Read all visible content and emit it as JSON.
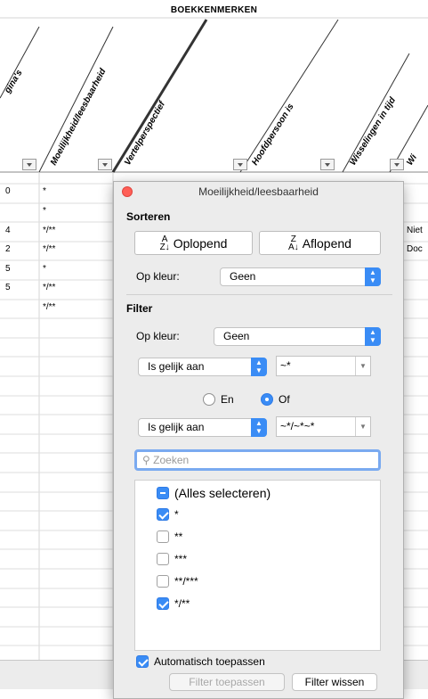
{
  "sheet": {
    "title": "BOEKKENMERKEN",
    "headers": [
      "gina's",
      "Moeilijkheid/leesbaarheid",
      "Vertelperspectief",
      "Hoofdpersoon is",
      "Wisselingen in tijd",
      "Wi"
    ],
    "col_a": [
      "0",
      "",
      "4",
      "2",
      "5",
      "5"
    ],
    "col_b": [
      "*",
      "*",
      "*/**",
      "*/**",
      "*",
      "*/**",
      "*/**"
    ],
    "col_right": [
      "Niet",
      "Doc"
    ]
  },
  "popup": {
    "title": "Moeilijkheid/leesbaarheid",
    "sort_section": "Sorteren",
    "sort_asc": "Oplopend",
    "sort_desc": "Aflopend",
    "sort_asc_icon": "AZ",
    "sort_desc_icon": "ZA",
    "sort_color_label": "Op kleur:",
    "sort_color_value": "Geen",
    "filter_section": "Filter",
    "filter_color_label": "Op kleur:",
    "filter_color_value": "Geen",
    "cond1_operator": "Is gelijk aan",
    "cond1_value": "~*",
    "and_label": "En",
    "or_label": "Of",
    "logic_selected": "Of",
    "cond2_operator": "Is gelijk aan",
    "cond2_value": "~*/~*~*",
    "search_placeholder": "Zoeken",
    "values": [
      {
        "label": "(Alles selecteren)",
        "state": "mixed"
      },
      {
        "label": "*",
        "state": "checked"
      },
      {
        "label": "**",
        "state": "unchecked"
      },
      {
        "label": "***",
        "state": "unchecked"
      },
      {
        "label": "**/***",
        "state": "unchecked"
      },
      {
        "label": "*/**",
        "state": "checked"
      }
    ],
    "auto_apply_label": "Automatisch toepassen",
    "auto_apply_checked": true,
    "apply_button": "Filter toepassen",
    "clear_button": "Filter wissen"
  },
  "colors": {
    "accent": "#3a8cf5",
    "close": "#ff5f57"
  }
}
